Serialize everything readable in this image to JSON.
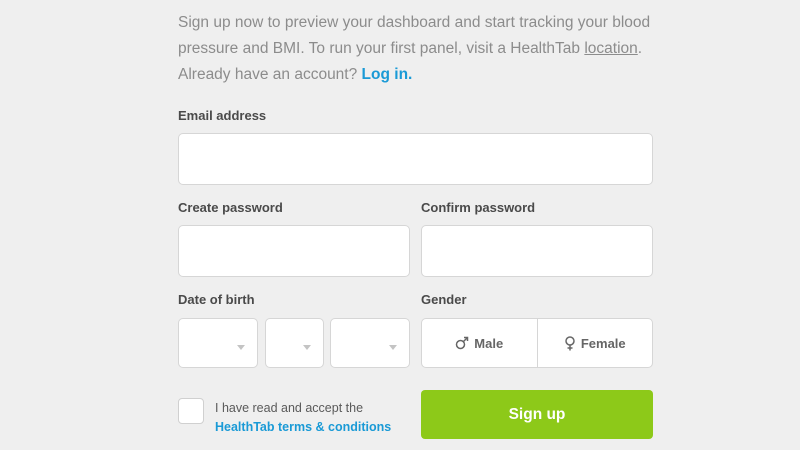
{
  "intro": {
    "text_before_link": "Sign up now to preview your dashboard and start tracking your blood pressure and BMI. To run your first panel, visit a HealthTab ",
    "location_link": "location",
    "text_after_link": ".",
    "already_text": "Already have an account?",
    "login_link": "Log in."
  },
  "form": {
    "email_label": "Email address",
    "email_value": "",
    "create_password_label": "Create password",
    "create_password_value": "",
    "confirm_password_label": "Confirm password",
    "confirm_password_value": "",
    "dob_label": "Date of birth",
    "dob": {
      "month": "",
      "day": "",
      "year": ""
    },
    "gender_label": "Gender",
    "gender_options": [
      {
        "label": "Male",
        "icon": "male-symbol-icon"
      },
      {
        "label": "Female",
        "icon": "female-symbol-icon"
      }
    ],
    "terms_text": "I have read and accept the",
    "terms_link": "HealthTab terms & conditions",
    "terms_checked": false,
    "signup_label": "Sign up"
  },
  "colors": {
    "background": "#efefef",
    "link_blue": "#1a9ad6",
    "signup_green": "#8dc919",
    "border": "#d6d6d6"
  }
}
